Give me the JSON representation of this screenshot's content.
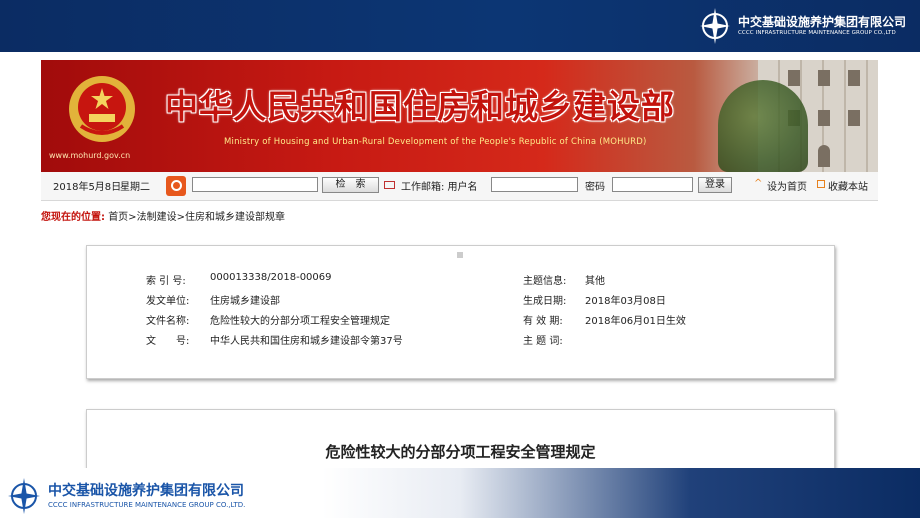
{
  "company": {
    "name_cn": "中交基础设施养护集团有限公司",
    "name_en_top": "CCCC INFRASTRUCTURE MAINTENANCE GROUP CO.,LTD",
    "name_en_bottom": "CCCC INFRASTRUCTURE MAINTENANCE GROUP CO.,LTD."
  },
  "banner": {
    "title": "中华人民共和国住房和城乡建设部",
    "subtitle": "Ministry of Housing and Urban-Rural Development of the People's Republic of China (MOHURD)",
    "url": "www.mohurd.gov.cn"
  },
  "navbar": {
    "date": "2018年5月8日",
    "weekday": "星期二",
    "search_button": "检　索",
    "mail_label": "工作邮箱: 用户名",
    "password_label": "密码",
    "login_button": "登录",
    "homepage_link": "设为首页",
    "favorite_link": "收藏本站"
  },
  "breadcrumb": {
    "prefix": "您现在的位置:",
    "path": "首页>法制建设>住房和城乡建设部规章"
  },
  "meta": {
    "index_label": "索 引 号:",
    "index_value": "000013338/2018-00069",
    "topic_label": "主题信息:",
    "topic_value": "其他",
    "issuer_label": "发文单位:",
    "issuer_value": "住房城乡建设部",
    "created_label": "生成日期:",
    "created_value": "2018年03月08日",
    "filename_label": "文件名称:",
    "filename_value": "危险性较大的分部分项工程安全管理规定",
    "valid_label": "有 效 期:",
    "valid_value": "2018年06月01日生效",
    "docno_label": "文　　号:",
    "docno_value": "中华人民共和国住房和城乡建设部令第37号",
    "keywords_label": "主 题 词:",
    "keywords_value": ""
  },
  "document": {
    "title": "危险性较大的分部分项工程安全管理规定"
  },
  "colors": {
    "navy": "#0b2c63",
    "banner_red": "#c3130d",
    "accent_blue": "#1a55a8"
  }
}
